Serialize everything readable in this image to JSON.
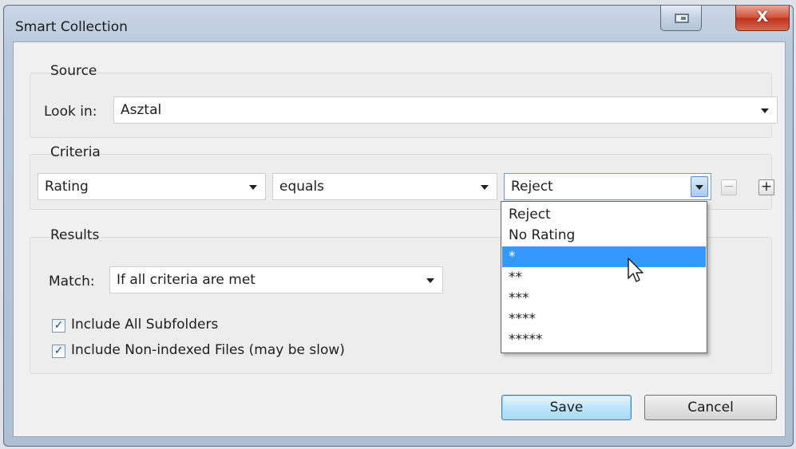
{
  "window": {
    "title": "Smart Collection",
    "close_label": "X"
  },
  "source": {
    "group_label": "Source",
    "look_in_label": "Look in:",
    "look_in_value": "Asztal"
  },
  "criteria": {
    "group_label": "Criteria",
    "field_value": "Rating",
    "operator_value": "equals",
    "value_value": "Reject",
    "remove_label": "−",
    "add_label": "+",
    "dropdown_options": [
      "Reject",
      "No Rating",
      "*",
      "**",
      "***",
      "****",
      "*****"
    ],
    "selected_index": 2
  },
  "results": {
    "group_label": "Results",
    "match_label": "Match:",
    "match_value": "If all criteria are met",
    "include_subfolders_label": "Include All Subfolders",
    "include_subfolders_checked": true,
    "include_nonindexed_label": "Include Non-indexed Files (may be slow)",
    "include_nonindexed_checked": true
  },
  "buttons": {
    "save_label": "Save",
    "cancel_label": "Cancel"
  }
}
